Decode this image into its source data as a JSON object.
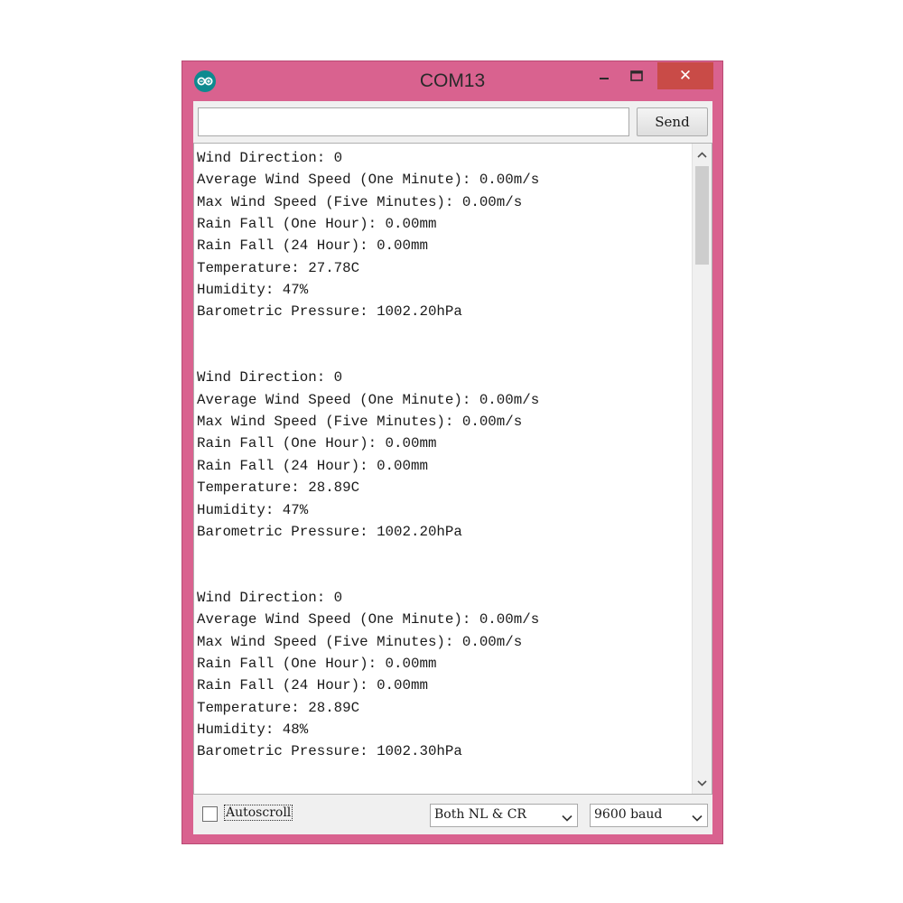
{
  "window": {
    "title": "COM13",
    "app_icon": "arduino-logo-icon",
    "controls": {
      "minimize": "minimize-icon",
      "maximize": "maximize-icon",
      "close_symbol": "✕"
    },
    "frame_color": "#d9628f",
    "close_color": "#c94b47"
  },
  "input": {
    "value": "",
    "send_label": "Send"
  },
  "output": {
    "lines": [
      "Wind Direction: 0",
      "Average Wind Speed (One Minute): 0.00m/s",
      "Max Wind Speed (Five Minutes): 0.00m/s",
      "Rain Fall (One Hour): 0.00mm",
      "Rain Fall (24 Hour): 0.00mm",
      "Temperature: 27.78C",
      "Humidity: 47%",
      "Barometric Pressure: 1002.20hPa",
      "",
      "",
      "Wind Direction: 0",
      "Average Wind Speed (One Minute): 0.00m/s",
      "Max Wind Speed (Five Minutes): 0.00m/s",
      "Rain Fall (One Hour): 0.00mm",
      "Rain Fall (24 Hour): 0.00mm",
      "Temperature: 28.89C",
      "Humidity: 47%",
      "Barometric Pressure: 1002.20hPa",
      "",
      "",
      "Wind Direction: 0",
      "Average Wind Speed (One Minute): 0.00m/s",
      "Max Wind Speed (Five Minutes): 0.00m/s",
      "Rain Fall (One Hour): 0.00mm",
      "Rain Fall (24 Hour): 0.00mm",
      "Temperature: 28.89C",
      "Humidity: 48%",
      "Barometric Pressure: 1002.30hPa"
    ],
    "scroll_up_icon": "chevron-up-icon",
    "scroll_down_icon": "chevron-down-icon"
  },
  "statusbar": {
    "autoscroll_label": "Autoscroll",
    "autoscroll_checked": false,
    "line_ending": "Both NL & CR",
    "baud_rate": "9600 baud"
  }
}
